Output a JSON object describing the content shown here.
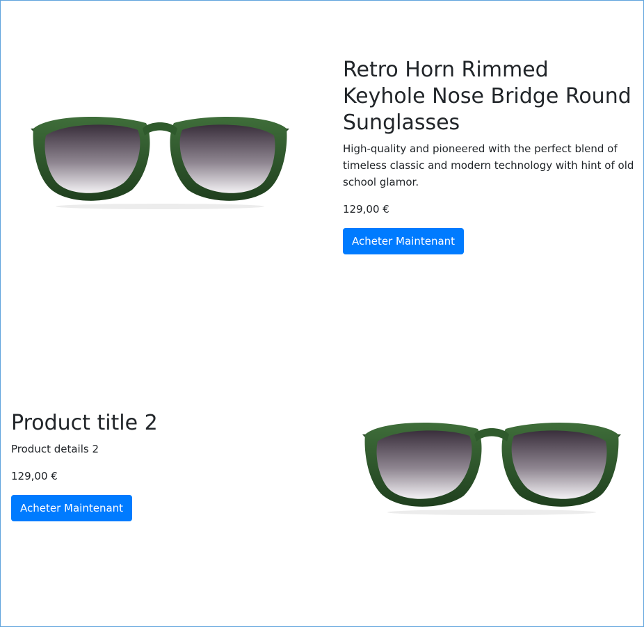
{
  "products": [
    {
      "title": "Retro Horn Rimmed Keyhole Nose Bridge Round Sunglasses",
      "details": "High-quality and pioneered with the perfect blend of timeless classic and modern technology with hint of old school glamor.",
      "price": "129,00 €",
      "button_label": "Acheter Maintenant",
      "image_icon": "sunglasses-image"
    },
    {
      "title": "Product title 2",
      "details": "Product details 2",
      "price": "129,00 €",
      "button_label": "Acheter Maintenant",
      "image_icon": "sunglasses-image"
    }
  ],
  "colors": {
    "accent": "#007bff",
    "frame_green": "#2f5a2c",
    "text": "#212529",
    "border": "#5fa3dc"
  }
}
